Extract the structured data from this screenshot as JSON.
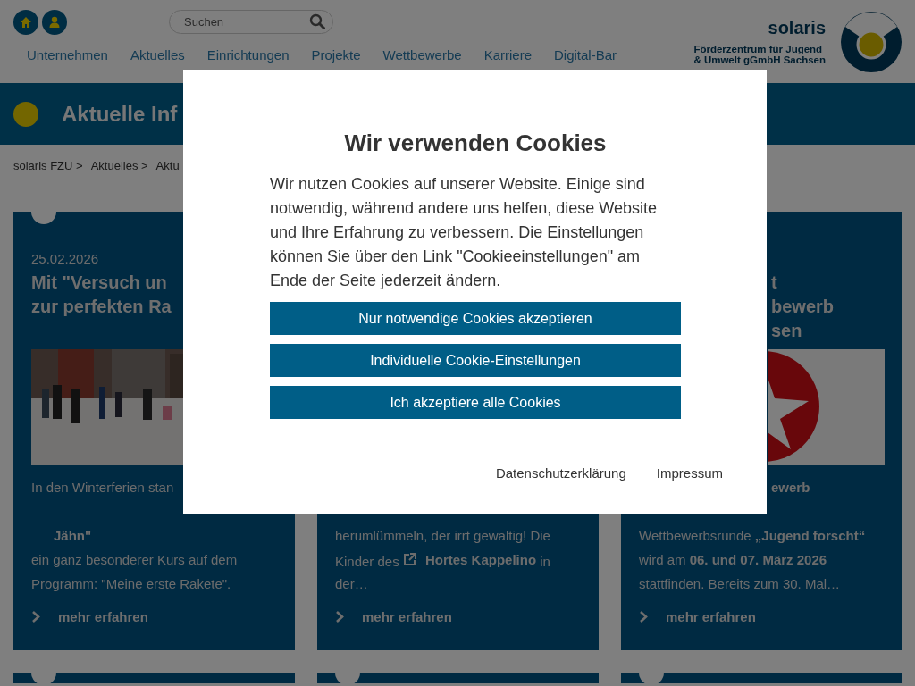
{
  "header": {
    "search": {
      "placeholder": "Suchen"
    },
    "nav": [
      {
        "label": "Unternehmen"
      },
      {
        "label": "Aktuelles"
      },
      {
        "label": "Einrichtungen"
      },
      {
        "label": "Projekte"
      },
      {
        "label": "Wettbewerbe"
      },
      {
        "label": "Karriere"
      },
      {
        "label": "Digital-Bar"
      }
    ],
    "brand": {
      "name": "solaris",
      "tagline": [
        "Förderzentrum für Jugend",
        "& Umwelt gGmbH Sachsen"
      ]
    }
  },
  "banner": {
    "title": "Aktuelle Inf"
  },
  "breadcrumb": [
    "solaris FZU >",
    "Aktuelles >",
    "Aktu"
  ],
  "cards": [
    {
      "kind": "article",
      "date": "25.02.2026",
      "title_lines": [
        "Mit \"Versuch un",
        "zur perfekten Ra"
      ],
      "picture": true,
      "lines_top": [
        {
          "kind": "text",
          "text": "In den Winterferien stan"
        }
      ],
      "lines": [
        {
          "kind": "link",
          "text": "Jähn\""
        },
        {
          "kind": "text",
          "text": "ein ganz besonderer Kurs auf dem"
        },
        {
          "kind": "text",
          "text": "Programm: \"Meine erste Rakete\"."
        }
      ],
      "more": "mehr erfahren"
    },
    {
      "kind": "article",
      "lines": [
        {
          "kind": "text",
          "text": "herumlümmeln, der irrt gewaltig! Die"
        },
        {
          "kind": "mixed",
          "before": "Kinder des",
          "link": "Hortes Kappelino",
          "after": "in"
        },
        {
          "kind": "text",
          "text": "der…"
        }
      ],
      "more": "mehr erfahren"
    },
    {
      "kind": "article_cut",
      "title_lines": [
        "t",
        "bewerb",
        "sen"
      ],
      "picture": true,
      "lines_top": [
        {
          "kind": "text",
          "text": "**ewerb**"
        }
      ],
      "lines": [
        {
          "kind": "text",
          "text": "Wettbewerbsrunde **„Jugend forscht“**"
        },
        {
          "kind": "text",
          "text": "wird am **06. und 07. März 2026**"
        },
        {
          "kind": "text",
          "text": "stattfinden. Bereits zum 30. Mal…"
        }
      ],
      "more": "mehr erfahren"
    },
    {
      "kind": "stub"
    },
    {
      "kind": "stub"
    },
    {
      "kind": "stub"
    }
  ],
  "cookie_dialog": {
    "title": "Wir verwenden Cookies",
    "text": "Wir nutzen Cookies auf unserer Website. Einige sind notwendig, während andere uns helfen, diese Website und Ihre Erfahrung zu verbessern. Die Einstellungen können Sie über den Link \"Cookieeinstellungen\" am Ende der Seite jederzeit ändern.",
    "buttons": [
      {
        "label": "Nur notwendige Cookies akzeptieren"
      },
      {
        "label": "Individuelle Cookie-Einstellungen"
      },
      {
        "label": "Ich akzeptiere alle Cookies"
      }
    ],
    "links": [
      {
        "label": "Datenschutzerklärung"
      },
      {
        "label": "Impressum"
      }
    ]
  }
}
